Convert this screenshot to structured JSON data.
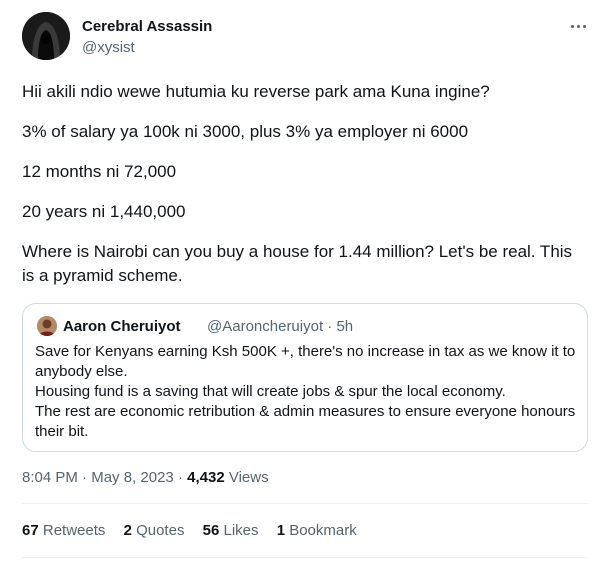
{
  "author": {
    "name": "Cerebral Assassin",
    "handle": "@xysist"
  },
  "tweet": {
    "paragraphs": [
      "Hii akili ndio wewe hutumia ku reverse park ama Kuna ingine?",
      "3% of salary ya 100k ni 3000, plus 3% ya employer ni 6000",
      "12 months ni 72,000",
      "20 years ni 1,440,000",
      "Where is Nairobi can you buy a house for 1.44 million? Let's be real. This is a pyramid scheme."
    ]
  },
  "quoted": {
    "name": "Aaron Cheruiyot",
    "handle": "@Aaroncheruiyot",
    "separator": "·",
    "time": "5h",
    "lines": [
      "Save for Kenyans earning Ksh 500K +,  there's no increase in tax as we know it to anybody else.",
      "Housing fund is a saving that will create jobs & spur the local economy.",
      "The rest are economic retribution & admin measures to ensure everyone honours their bit."
    ]
  },
  "meta": {
    "time": "8:04 PM",
    "separator": "·",
    "date": "May 8, 2023",
    "views_count": "4,432",
    "views_label": "Views"
  },
  "stats": {
    "retweets_count": "67",
    "retweets_label": "Retweets",
    "quotes_count": "2",
    "quotes_label": "Quotes",
    "likes_count": "56",
    "likes_label": "Likes",
    "bookmarks_count": "1",
    "bookmarks_label": "Bookmark"
  },
  "icons": {
    "avatar": "hooded-figure-avatar",
    "more": "more-dots-icon",
    "quoted_avatar": "person-avatar"
  },
  "colors": {
    "text": "#0f1419",
    "secondary": "#536471",
    "border": "#cfd9de"
  }
}
